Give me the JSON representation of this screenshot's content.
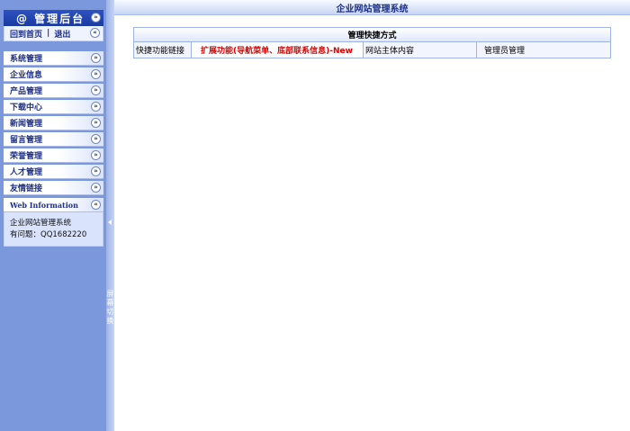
{
  "sidebar": {
    "brand_title": "@ 管理后台",
    "quick_links": {
      "home": "回到首页",
      "separator": "|",
      "logout": "退出"
    },
    "menu": [
      "系统管理",
      "企业信息",
      "产品管理",
      "下载中心",
      "新闻管理",
      "留言管理",
      "荣誉管理",
      "人才管理",
      "友情链接"
    ],
    "web_info": {
      "title": "Web Information",
      "line1": "企业网站管理系统",
      "line2": "有问题：QQ1682220"
    }
  },
  "splitter": {
    "label": "屏幕切换"
  },
  "header": {
    "title": "企业网站管理系统"
  },
  "shortcuts": {
    "title": "管理快捷方式",
    "cells": [
      "快捷功能链接",
      "扩展功能(导航菜单、底部联系信息)-New",
      "网站主体内容",
      "管理员管理"
    ]
  },
  "colors": {
    "sidebar_bg": "#7b98dc",
    "brand_bg": "#1a3aa0",
    "menu_text": "#1d2f86",
    "highlight_text": "#e00000"
  },
  "icons": {
    "collapse": "chevron-double-down-icon",
    "expand": "chevron-double-left-icon",
    "toggle": "triangle-left-icon"
  }
}
